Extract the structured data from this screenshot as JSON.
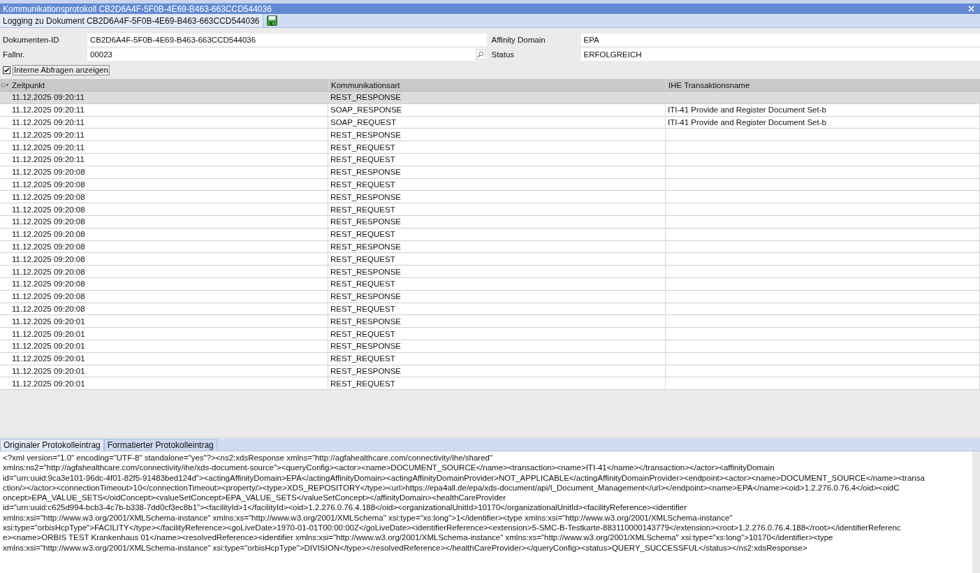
{
  "window": {
    "title": "Kommunikationsprotokoll CB2D6A4F-5F0B-4E69-B463-663CCD544036"
  },
  "document_tabs": [
    {
      "label": "Logging zu Dokument CB2D6A4F-5F0B-4E69-B463-663CCD544036",
      "selected": true
    }
  ],
  "form": {
    "fields": [
      {
        "label": "Dokumenten-ID",
        "value": "CB2D6A4F-5F0B-4E69-B463-663CCD544036",
        "kind": "text"
      },
      {
        "label": "Affinity Domain",
        "value": "EPA",
        "kind": "text"
      },
      {
        "label": "Fallnr.",
        "value": "00023",
        "kind": "search"
      },
      {
        "label": "Status",
        "value": "ERFOLGREICH",
        "kind": "text"
      }
    ]
  },
  "show_internal": {
    "label": "Interne Abfragen anzeigen",
    "checked": true
  },
  "table": {
    "columns": [
      "Zeitpunkt",
      "Kommunikationsart",
      "IHE Transaktionsname"
    ],
    "rows": [
      {
        "cells": [
          "11.12.2025 09:20:11",
          "REST_RESPONSE"
        ],
        "selected": true
      },
      {
        "cells": [
          "11.12.2025 09:20:11",
          "SOAP_RESPONSE",
          "ITI-41 Provide and Register Document Set-b"
        ],
        "selected": false
      },
      {
        "cells": [
          "11.12.2025 09:20:11",
          "SOAP_REQUEST",
          "ITI-41 Provide and Register Document Set-b"
        ],
        "selected": false
      },
      {
        "cells": [
          "11.12.2025 09:20:11",
          "REST_RESPONSE"
        ],
        "selected": false
      },
      {
        "cells": [
          "11.12.2025 09:20:11",
          "REST_REQUEST"
        ],
        "selected": false
      },
      {
        "cells": [
          "11.12.2025 09:20:11",
          "REST_REQUEST"
        ],
        "selected": false
      },
      {
        "cells": [
          "11.12.2025 09:20:08",
          "REST_RESPONSE"
        ],
        "selected": false
      },
      {
        "cells": [
          "11.12.2025 09:20:08",
          "REST_REQUEST"
        ],
        "selected": false
      },
      {
        "cells": [
          "11.12.2025 09:20:08",
          "REST_RESPONSE"
        ],
        "selected": false
      },
      {
        "cells": [
          "11.12.2025 09:20:08",
          "REST_REQUEST"
        ],
        "selected": false
      },
      {
        "cells": [
          "11.12.2025 09:20:08",
          "REST_RESPONSE"
        ],
        "selected": false
      },
      {
        "cells": [
          "11.12.2025 09:20:08",
          "REST_REQUEST"
        ],
        "selected": false
      },
      {
        "cells": [
          "11.12.2025 09:20:08",
          "REST_RESPONSE"
        ],
        "selected": false
      },
      {
        "cells": [
          "11.12.2025 09:20:08",
          "REST_REQUEST"
        ],
        "selected": false
      },
      {
        "cells": [
          "11.12.2025 09:20:08",
          "REST_RESPONSE"
        ],
        "selected": false
      },
      {
        "cells": [
          "11.12.2025 09:20:08",
          "REST_REQUEST"
        ],
        "selected": false
      },
      {
        "cells": [
          "11.12.2025 09:20:08",
          "REST_RESPONSE"
        ],
        "selected": false
      },
      {
        "cells": [
          "11.12.2025 09:20:08",
          "REST_REQUEST"
        ],
        "selected": false
      },
      {
        "cells": [
          "11.12.2025 09:20:01",
          "REST_RESPONSE"
        ],
        "selected": false
      },
      {
        "cells": [
          "11.12.2025 09:20:01",
          "REST_REQUEST"
        ],
        "selected": false
      },
      {
        "cells": [
          "11.12.2025 09:20:01",
          "REST_RESPONSE"
        ],
        "selected": false
      },
      {
        "cells": [
          "11.12.2025 09:20:01",
          "REST_REQUEST"
        ],
        "selected": false
      },
      {
        "cells": [
          "11.12.2025 09:20:01",
          "REST_RESPONSE"
        ],
        "selected": false
      },
      {
        "cells": [
          "11.12.2025 09:20:01",
          "REST_REQUEST"
        ],
        "selected": false
      }
    ]
  },
  "log_tabs": [
    {
      "label": "Originaler Protokolleintrag",
      "selected": true
    },
    {
      "label": "Formatierter Protokolleintrag",
      "selected": false
    }
  ],
  "log_text": {
    "lines": [
      "<?xml version=\"1.0\" encoding=\"UTF-8\" standalone=\"yes\"?><ns2:xdsResponse xmlns=\"http://agfahealthcare.com/connectivity/ihe/shared\"",
      "xmlns:ns2=\"http://agfahealthcare.com/connectivity/ihe/xds-document-source\"><queryConfig><actor><name>DOCUMENT_SOURCE</name><transaction><name>ITI-41</name></transaction></actor><affinityDomain",
      "id=\"urn:uuid:9ca3e101-96dc-4f01-82f5-91483bed124d\"><actingAffinityDomain>EPA</actingAffinityDomain><actingAffinityDomainProvider>NOT_APPLICABLE</actingAffinityDomainProvider><endpoint><actor><name>DOCUMENT_SOURCE</name><transa",
      "ction/></actor><connectionTimeout>10</connectionTimeout><property/><type>XDS_REPOSITORY</type><url>https://epa4all.de/epa/xds-document/api/I_Document_Management</url></endpoint><name>EPA</name><oid>1.2.276.0.76.4</oid><oidC",
      "oncept>EPA_VALUE_SETS</oidConcept><valueSetConcept>EPA_VALUE_SETS</valueSetConcept></affinityDomain><healthCareProvider",
      "id=\"urn:uuid:c625d994-bcb3-4c7b-b338-7dd0cf3ec8b1\"><facilityId>1</facilityId><oid>1.2.276.0.76.4.188</oid><organizationalUnitId>10170</organizationalUnitId><facilityReference><identifier",
      "xmlns:xsi=\"http://www.w3.org/2001/XMLSchema-instance\" xmlns:xs=\"http://www.w3.org/2001/XMLSchema\" xsi:type=\"xs:long\">1</identifier><type xmlns:xsi=\"http://www.w3.org/2001/XMLSchema-instance\"",
      "xsi:type=\"orbisHcpType\">FACILITY</type></facilityReference><goLiveDate>1970-01-01T00:00:00Z</goLiveDate><identifierReference><extension>5-SMC-B-Testkarte-883110000143779</extension><root>1.2.276.0.76.4.188</root></identifierReferenc",
      "e><name>ORBIS TEST Krankenhaus 01</name><resolvedReference><identifier xmlns:xsi=\"http://www.w3.org/2001/XMLSchema-instance\" xmlns:xs=\"http://www.w3.org/2001/XMLSchema\" xsi:type=\"xs:long\">10170</identifier><type",
      "xmlns:xsi=\"http://www.w3.org/2001/XMLSchema-instance\" xsi:type=\"orbisHcpType\">DIVISION</type></resolvedReference></healthCareProvider></queryConfig><status>QUERY_SUCCESSFUL</status></ns2:xdsResponse>"
    ]
  }
}
